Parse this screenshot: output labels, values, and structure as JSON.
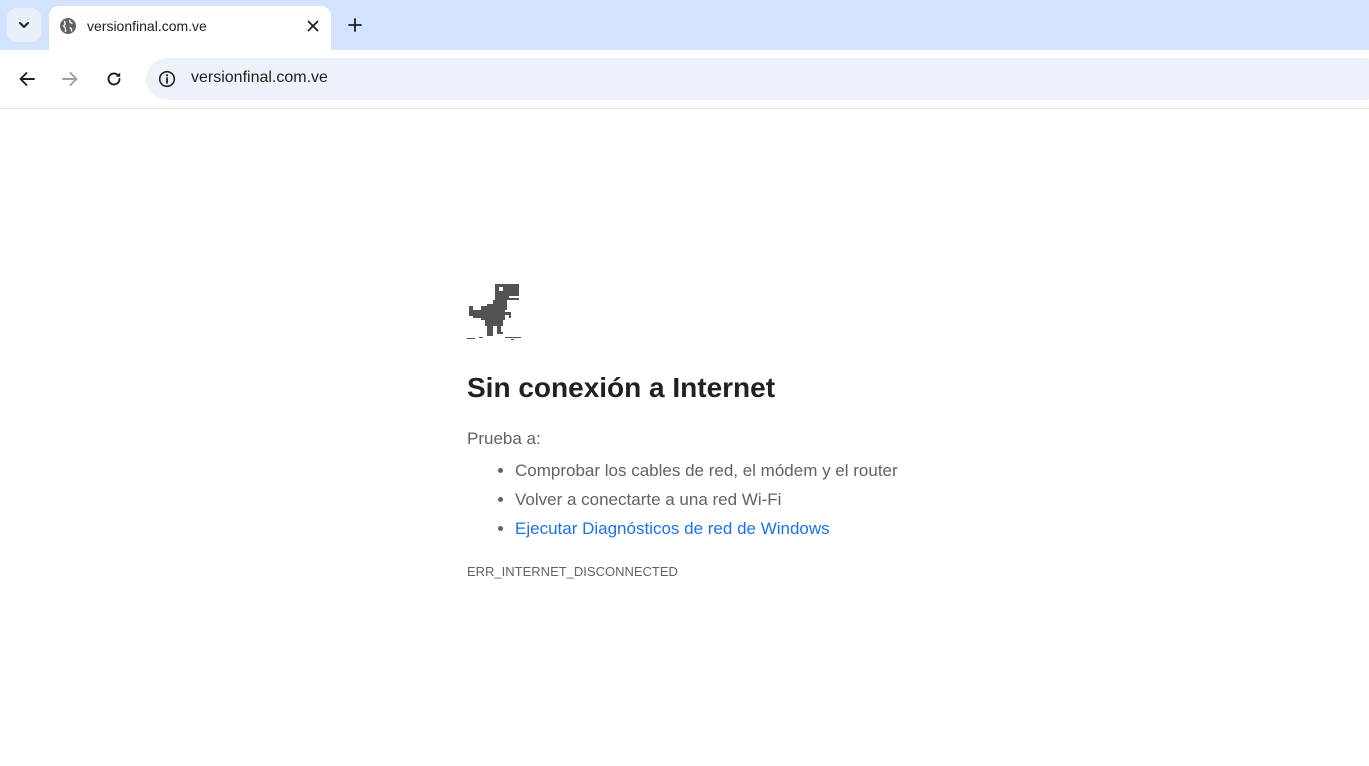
{
  "browser": {
    "tab": {
      "title": "versionfinal.com.ve",
      "favicon": "globe-icon"
    },
    "toolbar": {
      "url": "versionfinal.com.ve"
    },
    "icons": {
      "tab_search": "chevron-down-icon",
      "tab_close": "close-icon",
      "new_tab": "plus-icon",
      "back": "arrow-left-icon",
      "forward": "arrow-right-icon",
      "reload": "reload-icon",
      "site_info": "info-icon"
    },
    "colors": {
      "tabstrip": "#d3e3fd",
      "omnibox": "#edf2fa",
      "link": "#1a73e8"
    }
  },
  "error_page": {
    "heading": "Sin conexión a Internet",
    "try_label": "Prueba a:",
    "suggestions": [
      "Comprobar los cables de red, el módem y el router",
      "Volver a conectarte a una red Wi-Fi"
    ],
    "diagnostics_link": "Ejecutar Diagnósticos de red de Windows",
    "error_code": "ERR_INTERNET_DISCONNECTED",
    "icon": "dinosaur-icon"
  }
}
